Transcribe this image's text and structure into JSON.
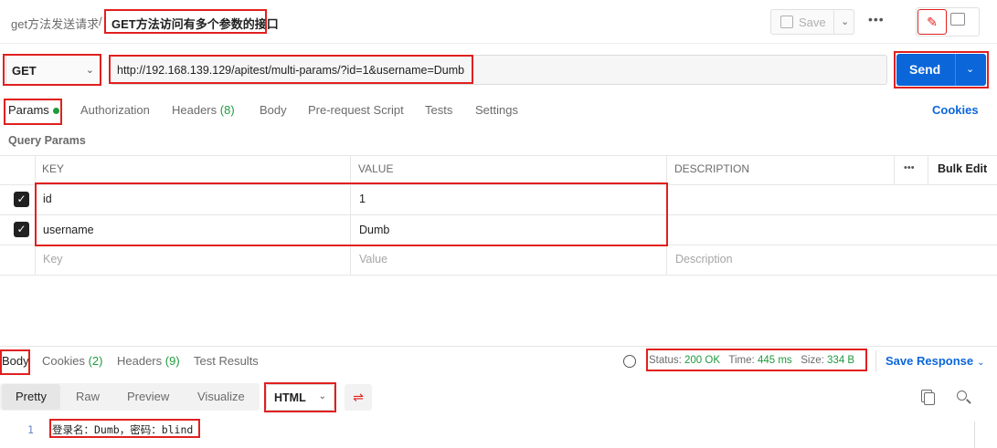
{
  "header": {
    "breadcrumb_parent": "get方法发送请求",
    "breadcrumb_separator": "/",
    "request_title": "GET方法访问有多个参数的接口",
    "save_label": "Save",
    "more_label": "•••"
  },
  "request": {
    "method": "GET",
    "url": "http://192.168.139.129/apitest/multi-params/?id=1&username=Dumb",
    "send_label": "Send"
  },
  "tabs": {
    "params": "Params",
    "authorization": "Authorization",
    "headers": "Headers",
    "headers_count": "(8)",
    "body": "Body",
    "prerequest": "Pre-request Script",
    "tests": "Tests",
    "settings": "Settings",
    "cookies": "Cookies"
  },
  "query_params": {
    "title": "Query Params",
    "columns": {
      "key": "KEY",
      "value": "VALUE",
      "description": "DESCRIPTION",
      "more": "•••",
      "bulk_edit": "Bulk Edit"
    },
    "rows": [
      {
        "key": "id",
        "value": "1",
        "checked": true
      },
      {
        "key": "username",
        "value": "Dumb",
        "checked": true
      }
    ],
    "placeholder": {
      "key": "Key",
      "value": "Value",
      "description": "Description"
    }
  },
  "response": {
    "tabs": {
      "body": "Body",
      "cookies": "Cookies",
      "cookies_count": "(2)",
      "headers": "Headers",
      "headers_count": "(9)",
      "test_results": "Test Results"
    },
    "status_label": "Status:",
    "status_value": "200 OK",
    "time_label": "Time:",
    "time_value": "445 ms",
    "size_label": "Size:",
    "size_value": "334 B",
    "save_response": "Save Response",
    "formats": {
      "pretty": "Pretty",
      "raw": "Raw",
      "preview": "Preview",
      "visualize": "Visualize"
    },
    "language": "HTML",
    "line_number": "1",
    "code_line": "登录名：Dumb，密码：blind"
  },
  "colors": {
    "accent": "#0b66da",
    "success": "#1f9a3e",
    "highlight": "#e0201f"
  }
}
